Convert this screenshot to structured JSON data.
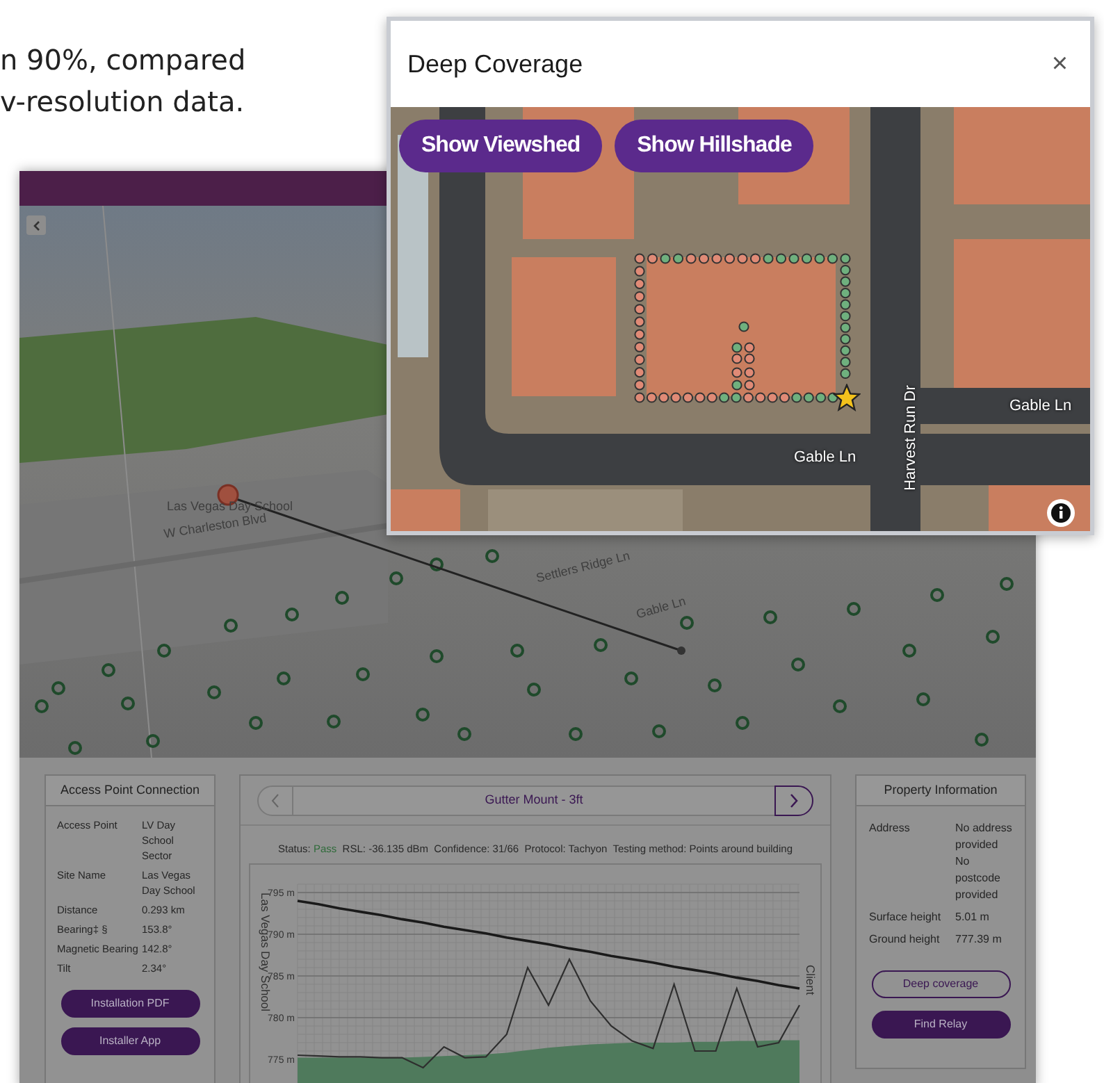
{
  "background_text": {
    "lines": [
      "n 90%, compared",
      "v-resolution data."
    ]
  },
  "map_3d": {
    "labels": [
      "W Charleston Blvd",
      "Las Vegas Day School",
      "Settlers Ridge Ln",
      "Gable Ln"
    ]
  },
  "access_point_card": {
    "title": "Access Point Connection",
    "rows": [
      {
        "label": "Access Point",
        "value": "LV Day School Sector"
      },
      {
        "label": "Site Name",
        "value": "Las Vegas Day School"
      },
      {
        "label": "Distance",
        "value": "0.293 km"
      },
      {
        "label": "Bearing‡ §",
        "value": "153.8°"
      },
      {
        "label": "Magnetic Bearing",
        "value": "142.8°"
      },
      {
        "label": "Tilt",
        "value": "2.34°"
      }
    ],
    "buttons": [
      {
        "label": "Installation PDF",
        "kind": "filled"
      },
      {
        "label": "Installer App",
        "kind": "filled"
      }
    ]
  },
  "profile_panel": {
    "title": "Gutter Mount - 3ft",
    "status": {
      "label": "Status:",
      "value": "Pass",
      "passed": true
    },
    "details": "RSL: -36.135 dBm  Confidence: 31/66  Protocol: Tachyon  Testing method: Points around building",
    "end_label": "Client",
    "chart_data": {
      "type": "line",
      "ylabel": "Las Vegas Day School",
      "grid": true,
      "ylim": [
        772,
        796
      ],
      "yticks": [
        {
          "value": 795,
          "label": "795 m"
        },
        {
          "value": 790,
          "label": "790 m"
        },
        {
          "value": 785,
          "label": "785 m"
        },
        {
          "value": 780,
          "label": "780 m"
        },
        {
          "value": 775,
          "label": "775 m"
        }
      ],
      "series": [
        {
          "type": "line",
          "color": "#1a1a1a",
          "values": [
            794,
            793.6,
            793.1,
            792.7,
            792.3,
            791.8,
            791.4,
            790.9,
            790.5,
            790.1,
            789.6,
            789.2,
            788.8,
            788.3,
            787.9,
            787.4,
            787,
            786.6,
            786.1,
            785.7,
            785.3,
            784.8,
            784.4,
            783.9,
            783.5
          ]
        },
        {
          "type": "line",
          "color": "#2e2e2e",
          "values": [
            775.5,
            775.4,
            775.3,
            775.3,
            775.2,
            775.2,
            774,
            776.5,
            775.2,
            775.3,
            778,
            786,
            781.5,
            787,
            782,
            779,
            777.2,
            776.3,
            784,
            776,
            776,
            783.5,
            776.5,
            777,
            781.5
          ]
        },
        {
          "type": "area",
          "color": "#4f7a5c",
          "values": [
            775.2,
            775.2,
            775.2,
            775.2,
            775.2,
            775.2,
            775.3,
            775.4,
            775.5,
            775.6,
            775.8,
            776.1,
            776.4,
            776.6,
            776.8,
            776.9,
            777,
            777,
            777,
            777.1,
            777.1,
            777.2,
            777.2,
            777.3,
            777.3
          ]
        }
      ]
    }
  },
  "property_card": {
    "title": "Property Information",
    "rows": [
      {
        "label": "Address",
        "values": [
          "No address provided",
          "No postcode provided"
        ]
      },
      {
        "label": "Surface height",
        "values": [
          "5.01 m"
        ]
      },
      {
        "label": "Ground height",
        "values": [
          "777.39 m"
        ]
      }
    ],
    "buttons": [
      {
        "label": "Deep coverage",
        "kind": "outline"
      },
      {
        "label": "Find Relay",
        "kind": "filled"
      }
    ]
  },
  "popup": {
    "title": "Deep Coverage",
    "close": "×",
    "buttons": [
      "Show Viewshed",
      "Show Hillshade"
    ],
    "map_labels": [
      "Gable Ln",
      "Harvest Run Dr",
      "Gable Ln"
    ],
    "coverage_points": {
      "top": [
        {
          "passed": false
        },
        {
          "passed": false
        },
        {
          "passed": true
        },
        {
          "passed": true
        },
        {
          "passed": false
        },
        {
          "passed": false
        },
        {
          "passed": false
        },
        {
          "passed": false
        },
        {
          "passed": false
        },
        {
          "passed": false
        },
        {
          "passed": true
        },
        {
          "passed": true
        },
        {
          "passed": true
        },
        {
          "passed": true
        },
        {
          "passed": true
        },
        {
          "passed": true
        },
        {
          "passed": true
        }
      ],
      "left": [
        {
          "passed": false
        },
        {
          "passed": false
        },
        {
          "passed": false
        },
        {
          "passed": false
        },
        {
          "passed": false
        },
        {
          "passed": false
        },
        {
          "passed": false
        },
        {
          "passed": false
        },
        {
          "passed": false
        },
        {
          "passed": false
        }
      ],
      "right": [
        {
          "passed": true
        },
        {
          "passed": true
        },
        {
          "passed": true
        },
        {
          "passed": true
        },
        {
          "passed": true
        },
        {
          "passed": true
        },
        {
          "passed": true
        },
        {
          "passed": true
        },
        {
          "passed": true
        },
        {
          "passed": true
        }
      ],
      "bottom": [
        {
          "passed": false
        },
        {
          "passed": false
        },
        {
          "passed": false
        },
        {
          "passed": false
        },
        {
          "passed": false
        },
        {
          "passed": false
        },
        {
          "passed": false
        },
        {
          "passed": true
        },
        {
          "passed": true
        },
        {
          "passed": false
        },
        {
          "passed": false
        },
        {
          "passed": false
        },
        {
          "passed": false
        },
        {
          "passed": true
        },
        {
          "passed": true
        },
        {
          "passed": true
        },
        {
          "passed": true
        }
      ],
      "inner": [
        {
          "passed": true
        },
        {
          "passed": true
        },
        {
          "passed": false
        },
        {
          "passed": false
        },
        {
          "passed": false
        },
        {
          "passed": false
        },
        {
          "passed": false
        },
        {
          "passed": true
        },
        {
          "passed": false
        }
      ]
    }
  }
}
